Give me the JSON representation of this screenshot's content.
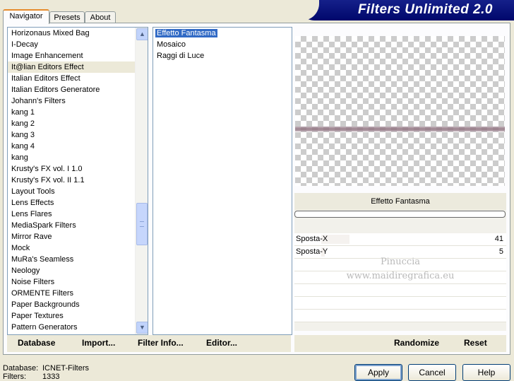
{
  "tabs": [
    "Navigator",
    "Presets",
    "About"
  ],
  "app_title": "Filters Unlimited 2.0",
  "categories": [
    "Horizonaus Mixed Bag",
    "I-Decay",
    "Image Enhancement",
    "It@lian Editors Effect",
    "Italian Editors Effect",
    "Italian Editors Generatore",
    "Johann's Filters",
    "kang 1",
    "kang 2",
    "kang 3",
    "kang 4",
    "kang",
    "Krusty's FX vol. I 1.0",
    "Krusty's FX vol. II 1.1",
    "Layout Tools",
    "Lens Effects",
    "Lens Flares",
    "MediaSpark Filters",
    "Mirror Rave",
    "Mock",
    "MuRa's Seamless",
    "Neology",
    "Noise Filters",
    "ORMENTE Filters",
    "Paper Backgrounds",
    "Paper Textures",
    "Pattern Generators"
  ],
  "selected_category": "It@lian Editors Effect",
  "filters": [
    "Effetto Fantasma",
    "Mosaico",
    "Raggi di Luce"
  ],
  "selected_filter": "Effetto Fantasma",
  "filter_name": "Effetto Fantasma",
  "params": [
    {
      "label": "Sposta-X",
      "value": "41",
      "fraction": 0.16
    },
    {
      "label": "Sposta-Y",
      "value": "5",
      "fraction": 0.02
    }
  ],
  "watermark": {
    "line1": "Pinuccia",
    "line2": "www.maidiregrafica.eu"
  },
  "left_buttons": {
    "database": "Database",
    "import": "Import...",
    "filter_info": "Filter Info...",
    "editor": "Editor..."
  },
  "right_buttons": {
    "randomize": "Randomize",
    "reset": "Reset"
  },
  "status": {
    "database_label": "Database:",
    "database_value": "ICNET-Filters",
    "filters_label": "Filters:",
    "filters_value": "1333"
  },
  "dialog_buttons": {
    "apply": "Apply",
    "cancel": "Cancel",
    "help": "Help"
  },
  "colors": {
    "banner": "#00076b",
    "selection": "#316ac5",
    "active_tab_accent": "#e68b2c"
  }
}
